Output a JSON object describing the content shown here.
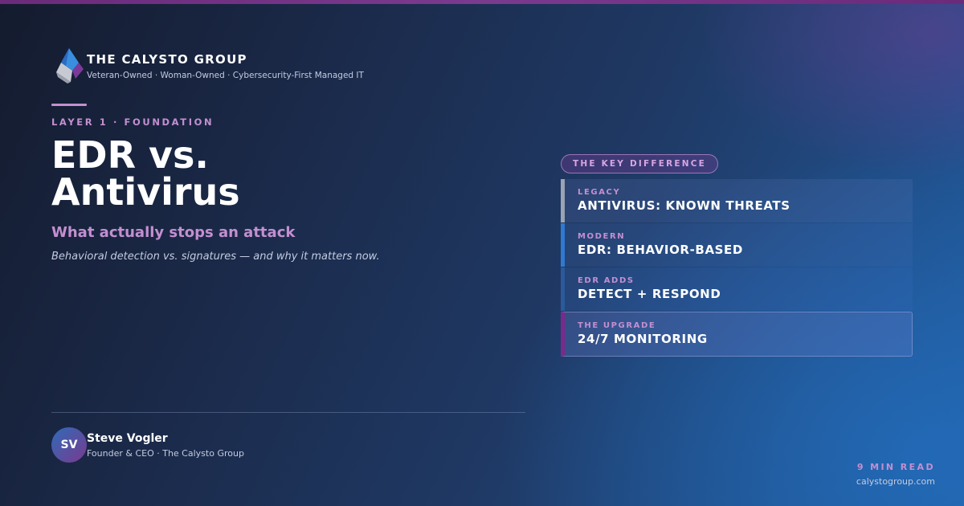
{
  "brand": {
    "name": "THE CALYSTO GROUP",
    "tagline": "Veteran-Owned · Woman-Owned · Cybersecurity-First Managed IT"
  },
  "hero": {
    "eyebrow": "LAYER 1 · FOUNDATION",
    "title_line1": "EDR vs.",
    "title_line2": "Antivirus",
    "subtitle": "What actually stops an attack",
    "description": "Behavioral detection vs. signatures — and why it matters now."
  },
  "author": {
    "initials": "SV",
    "name": "Steve Vogler",
    "role": "Founder & CEO · The Calysto Group"
  },
  "comparison": {
    "badge": "THE KEY DIFFERENCE",
    "rows": [
      {
        "label": "LEGACY",
        "value": "ANTIVIRUS: KNOWN THREATS"
      },
      {
        "label": "MODERN",
        "value": "EDR: BEHAVIOR-BASED"
      },
      {
        "label": "EDR ADDS",
        "value": "DETECT + RESPOND"
      },
      {
        "label": "THE UPGRADE",
        "value": "24/7 MONITORING"
      }
    ]
  },
  "footer": {
    "read_time": "9 MIN READ",
    "website": "calystogroup.com"
  },
  "colors": {
    "accent": "#c38fd0",
    "background_dark": "#141b2e",
    "background_blue": "#215ea3",
    "top_bar": "#6b2a7a"
  },
  "icons": {
    "logo": "calysto-logo-icon"
  }
}
